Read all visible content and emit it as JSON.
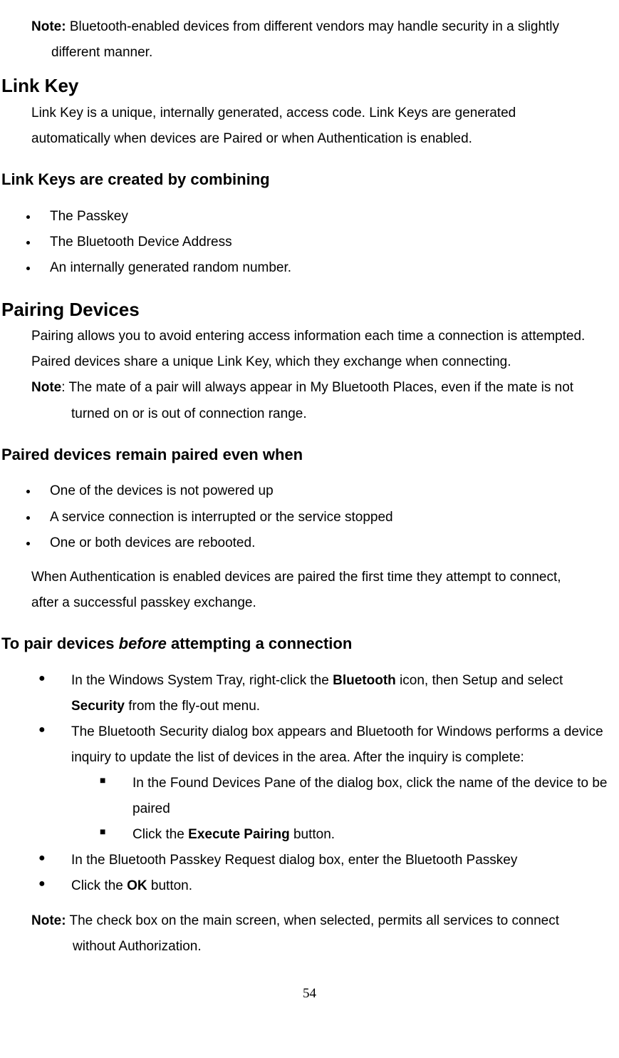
{
  "top_note_label": "Note:",
  "top_note_text": " Bluetooth-enabled devices from different vendors may handle security in a slightly",
  "top_note_cont": "different manner.",
  "h_linkkey": "Link Key",
  "p_linkkey1": "Link Key is a unique, internally generated, access code. Link Keys are generated",
  "p_linkkey2": "automatically when devices are Paired or when Authentication is enabled.",
  "h_combining": "Link Keys are created by combining",
  "li_comb1": "The Passkey",
  "li_comb2": "The Bluetooth Device Address",
  "li_comb3": "An internally generated random number.",
  "h_pairing": "Pairing Devices",
  "p_pair1": "Pairing allows you to avoid entering access information each time a connection is attempted.",
  "p_pair2": "Paired devices share a unique Link Key, which they exchange when connecting.",
  "note_pair_label": "Note",
  "note_pair_text": ": The mate of a pair will always appear in My Bluetooth Places, even if the mate is not",
  "note_pair_cont": "turned on or is out of connection range.",
  "h_remain": "Paired devices remain paired even when",
  "li_rem1": "One of the devices is not powered up",
  "li_rem2": "A service connection is interrupted or the service stopped",
  "li_rem3": "One or both devices are rebooted.",
  "p_remain_after1": "When Authentication is enabled devices are paired the first time they attempt to connect,",
  "p_remain_after2": "after a successful passkey exchange.",
  "h_topair_pre": "To pair devices ",
  "h_topair_em": "before",
  "h_topair_post": " attempting a connection",
  "li_tp1_a": "In the Windows System Tray, right-click the ",
  "li_tp1_b": "Bluetooth",
  "li_tp1_c": " icon, then Setup and select ",
  "li_tp1_d": "Security",
  "li_tp1_e": " from the fly-out menu.",
  "li_tp2": "The Bluetooth Security dialog box appears and Bluetooth for Windows performs a device inquiry to update the list of devices in the area. After the inquiry is complete:",
  "li_sq1": "In the Found Devices Pane of the dialog box, click the name of the device to be paired",
  "li_sq2_a": "Click the ",
  "li_sq2_b": "Execute Pairing",
  "li_sq2_c": " button.",
  "li_tp3": "In the Bluetooth Passkey Request dialog box, enter the Bluetooth Passkey",
  "li_tp4_a": "Click the ",
  "li_tp4_b": "OK",
  "li_tp4_c": " button.",
  "note_end_label": "Note:",
  "note_end_text": " The check box on the main screen, when selected, permits all services to connect",
  "note_end_cont": "without Authorization.",
  "page_number": "54"
}
